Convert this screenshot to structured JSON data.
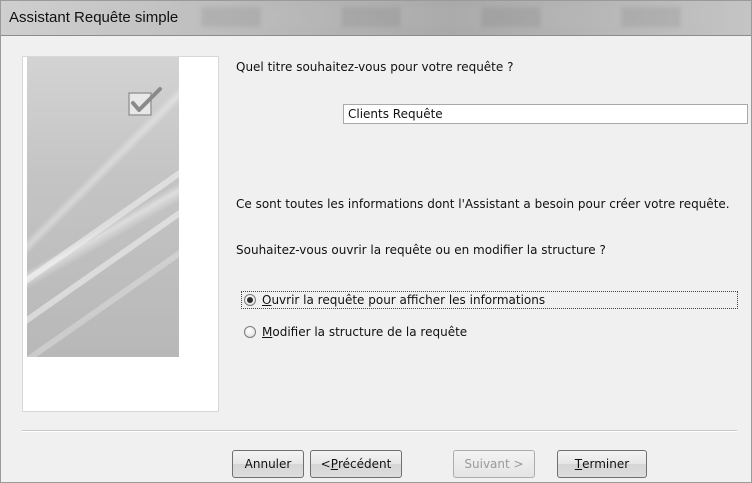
{
  "window": {
    "title": "Assistant Requête simple"
  },
  "wizard": {
    "title_question": "Quel titre souhaitez-vous pour votre requête ?",
    "title_value": "Clients Requête",
    "info_text": "Ce sont toutes les informations dont l'Assistant a besoin pour créer votre requête.",
    "open_question": "Souhaitez-vous ouvrir la requête ou en modifier la structure ?",
    "options": [
      {
        "label_mnemonic": "O",
        "label_rest": "uvrir la requête pour afficher les informations",
        "selected": true
      },
      {
        "label_mnemonic": "M",
        "label_rest": "odifier la structure de la requête",
        "selected": false
      }
    ]
  },
  "buttons": {
    "cancel": "Annuler",
    "previous_prefix": "< ",
    "previous_mnemonic": "P",
    "previous_rest": "récédent",
    "next": "Suivant >",
    "finish_mnemonic": "T",
    "finish_rest": "erminer"
  },
  "icons": {
    "side_image": "wizard-illustration",
    "check": "checkmark-icon"
  },
  "colors": {
    "window_bg": "#f0f0f0",
    "disabled_text": "#9a9a9a"
  }
}
